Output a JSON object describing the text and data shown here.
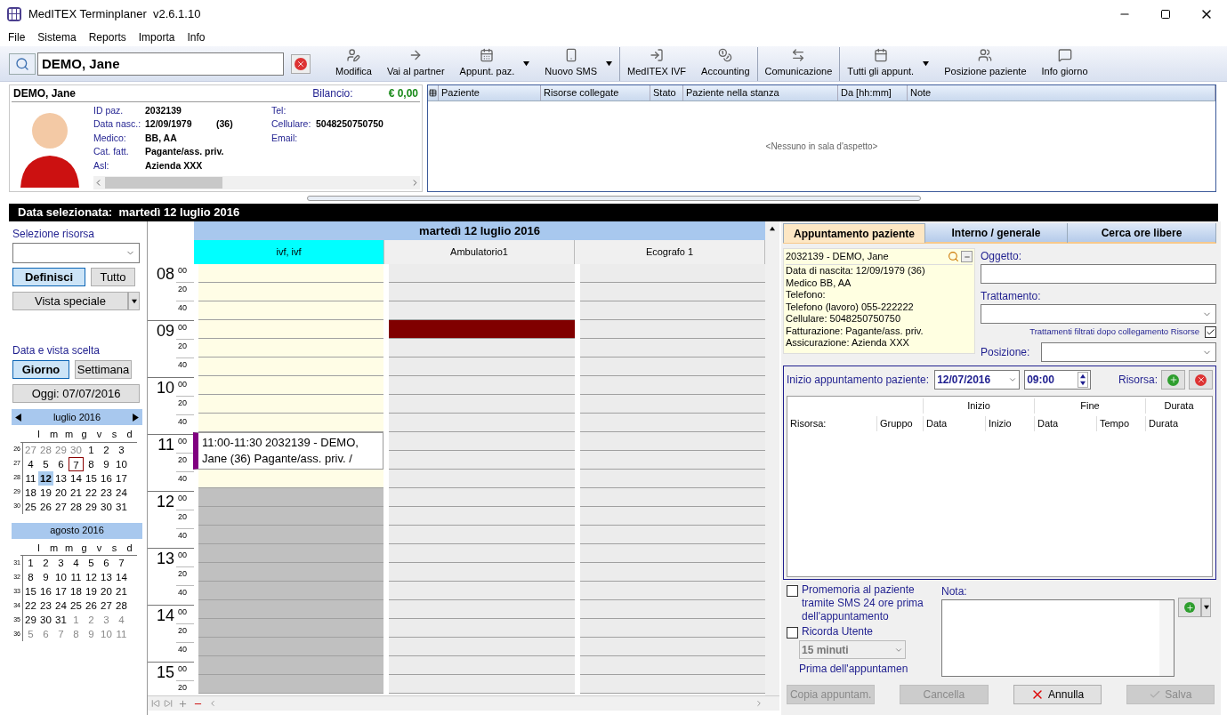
{
  "window": {
    "title": "MedITEX Terminplaner  v2.6.1.10"
  },
  "menu": [
    "File",
    "Sistema",
    "Reports",
    "Importa",
    "Info"
  ],
  "search": {
    "value": "DEMO, Jane"
  },
  "toolbar": [
    {
      "label": "Modifica",
      "dropdown": false,
      "separator_after": false
    },
    {
      "label": "Vai al partner",
      "dropdown": false,
      "separator_after": false
    },
    {
      "label": "Appunt. paz.",
      "dropdown": true,
      "separator_after": false
    },
    {
      "label": "Nuovo SMS",
      "dropdown": true,
      "separator_after": true
    },
    {
      "label": "MedITEX IVF",
      "dropdown": false,
      "separator_after": false
    },
    {
      "label": "Accounting",
      "dropdown": false,
      "separator_after": true
    },
    {
      "label": "Comunicazione",
      "dropdown": false,
      "separator_after": true
    },
    {
      "label": "Tutti gli appunt.",
      "dropdown": true,
      "separator_after": false
    },
    {
      "label": "Posizione paziente",
      "dropdown": false,
      "separator_after": false
    },
    {
      "label": "Info giorno",
      "dropdown": false,
      "separator_after": false
    }
  ],
  "patient": {
    "name": "DEMO, Jane",
    "balance_label": "Bilancio:",
    "balance": "€ 0,00",
    "fields": [
      {
        "label": "ID paz.",
        "value": "2032139"
      },
      {
        "label": "Data nasc.:",
        "value": "12/09/1979",
        "extra": "(36)"
      },
      {
        "label": "Medico:",
        "value": "BB, AA"
      },
      {
        "label": "Cat. fatt.",
        "value": "Pagante/ass. priv."
      },
      {
        "label": "Asl:",
        "value": "Azienda XXX"
      }
    ],
    "contact": [
      {
        "label": "Tel:"
      },
      {
        "label": "Cellulare:",
        "value": "5048250750750"
      },
      {
        "label": "Email:"
      }
    ]
  },
  "waiting_room": {
    "columns": [
      "Paziente",
      "Risorse collegate",
      "Stato",
      "Paziente nella stanza",
      "Da [hh:mm]",
      "Note"
    ],
    "empty_text": "<Nessuno in sala d'aspetto>"
  },
  "selected_date_bar": "Data selezionata:  martedì 12 luglio 2016",
  "sidebar": {
    "resource_label": "Selezione risorsa",
    "resource_buttons": [
      {
        "label": "Definisci",
        "selected": true
      },
      {
        "label": "Tutto",
        "selected": false
      }
    ],
    "special_view": "Vista speciale",
    "view_label": "Data e vista scelta",
    "view_buttons": [
      {
        "label": "Giorno",
        "selected": true
      },
      {
        "label": "Settimana",
        "selected": false
      }
    ],
    "today_button": "Oggi: 07/07/2016",
    "months": [
      {
        "title": "luglio 2016",
        "nav": true,
        "weekdays": [
          "l",
          "m",
          "m",
          "g",
          "v",
          "s",
          "d"
        ],
        "weeks": [
          {
            "number": "26",
            "days": [
              {
                "label": "27",
                "kind": "other"
              },
              {
                "label": "28",
                "kind": "other"
              },
              {
                "label": "29",
                "kind": "other"
              },
              {
                "label": "30",
                "kind": "other"
              },
              {
                "label": "1",
                "kind": "day"
              },
              {
                "label": "2",
                "kind": "day"
              },
              {
                "label": "3",
                "kind": "day"
              }
            ]
          },
          {
            "number": "27",
            "days": [
              {
                "label": "4",
                "kind": "day"
              },
              {
                "label": "5",
                "kind": "day"
              },
              {
                "label": "6",
                "kind": "day"
              },
              {
                "label": "7",
                "kind": "today"
              },
              {
                "label": "8",
                "kind": "day"
              },
              {
                "label": "9",
                "kind": "day"
              },
              {
                "label": "10",
                "kind": "day"
              }
            ]
          },
          {
            "number": "28",
            "days": [
              {
                "label": "11",
                "kind": "day"
              },
              {
                "label": "12",
                "kind": "selected"
              },
              {
                "label": "13",
                "kind": "day"
              },
              {
                "label": "14",
                "kind": "day"
              },
              {
                "label": "15",
                "kind": "day"
              },
              {
                "label": "16",
                "kind": "day"
              },
              {
                "label": "17",
                "kind": "day"
              }
            ]
          },
          {
            "number": "29",
            "days": [
              {
                "label": "18",
                "kind": "day"
              },
              {
                "label": "19",
                "kind": "day"
              },
              {
                "label": "20",
                "kind": "day"
              },
              {
                "label": "21",
                "kind": "day"
              },
              {
                "label": "22",
                "kind": "day"
              },
              {
                "label": "23",
                "kind": "day"
              },
              {
                "label": "24",
                "kind": "day"
              }
            ]
          },
          {
            "number": "30",
            "days": [
              {
                "label": "25",
                "kind": "day"
              },
              {
                "label": "26",
                "kind": "day"
              },
              {
                "label": "27",
                "kind": "day"
              },
              {
                "label": "28",
                "kind": "day"
              },
              {
                "label": "29",
                "kind": "day"
              },
              {
                "label": "30",
                "kind": "day"
              },
              {
                "label": "31",
                "kind": "day"
              }
            ]
          }
        ]
      },
      {
        "title": "agosto 2016",
        "nav": false,
        "weekdays": [
          "l",
          "m",
          "m",
          "g",
          "v",
          "s",
          "d"
        ],
        "weeks": [
          {
            "number": "31",
            "days": [
              {
                "label": "1",
                "kind": "day"
              },
              {
                "label": "2",
                "kind": "day"
              },
              {
                "label": "3",
                "kind": "day"
              },
              {
                "label": "4",
                "kind": "day"
              },
              {
                "label": "5",
                "kind": "day"
              },
              {
                "label": "6",
                "kind": "day"
              },
              {
                "label": "7",
                "kind": "day"
              }
            ]
          },
          {
            "number": "32",
            "days": [
              {
                "label": "8",
                "kind": "day"
              },
              {
                "label": "9",
                "kind": "day"
              },
              {
                "label": "10",
                "kind": "day"
              },
              {
                "label": "11",
                "kind": "day"
              },
              {
                "label": "12",
                "kind": "day"
              },
              {
                "label": "13",
                "kind": "day"
              },
              {
                "label": "14",
                "kind": "day"
              }
            ]
          },
          {
            "number": "33",
            "days": [
              {
                "label": "15",
                "kind": "day"
              },
              {
                "label": "16",
                "kind": "day"
              },
              {
                "label": "17",
                "kind": "day"
              },
              {
                "label": "18",
                "kind": "day"
              },
              {
                "label": "19",
                "kind": "day"
              },
              {
                "label": "20",
                "kind": "day"
              },
              {
                "label": "21",
                "kind": "day"
              }
            ]
          },
          {
            "number": "34",
            "days": [
              {
                "label": "22",
                "kind": "day"
              },
              {
                "label": "23",
                "kind": "day"
              },
              {
                "label": "24",
                "kind": "day"
              },
              {
                "label": "25",
                "kind": "day"
              },
              {
                "label": "26",
                "kind": "day"
              },
              {
                "label": "27",
                "kind": "day"
              },
              {
                "label": "28",
                "kind": "day"
              }
            ]
          },
          {
            "number": "35",
            "days": [
              {
                "label": "29",
                "kind": "day"
              },
              {
                "label": "30",
                "kind": "day"
              },
              {
                "label": "31",
                "kind": "day"
              },
              {
                "label": "1",
                "kind": "other"
              },
              {
                "label": "2",
                "kind": "other"
              },
              {
                "label": "3",
                "kind": "other"
              },
              {
                "label": "4",
                "kind": "other"
              }
            ]
          },
          {
            "number": "36",
            "days": [
              {
                "label": "5",
                "kind": "other"
              },
              {
                "label": "6",
                "kind": "other"
              },
              {
                "label": "7",
                "kind": "other"
              },
              {
                "label": "8",
                "kind": "other"
              },
              {
                "label": "9",
                "kind": "other"
              },
              {
                "label": "10",
                "kind": "other"
              },
              {
                "label": "11",
                "kind": "other"
              }
            ]
          }
        ]
      }
    ]
  },
  "day_view": {
    "title": "martedì 12 luglio 2016",
    "hours": [
      {
        "hour": "08",
        "minutes": [
          "00",
          "20",
          "40"
        ]
      },
      {
        "hour": "09",
        "minutes": [
          "00",
          "20",
          "40"
        ]
      },
      {
        "hour": "10",
        "minutes": [
          "00",
          "20",
          "40"
        ]
      },
      {
        "hour": "11",
        "minutes": [
          "00",
          "20",
          "40"
        ]
      },
      {
        "hour": "12",
        "minutes": [
          "00",
          "20",
          "40"
        ]
      },
      {
        "hour": "13",
        "minutes": [
          "00",
          "20",
          "40"
        ]
      },
      {
        "hour": "14",
        "minutes": [
          "00",
          "20",
          "40"
        ]
      },
      {
        "hour": "15",
        "minutes": [
          "00",
          "20"
        ]
      }
    ],
    "columns": [
      {
        "label": "ivf, ivf",
        "highlighted": true,
        "slots": [
          {
            "kind": "open"
          },
          {
            "kind": "open"
          },
          {
            "kind": "open"
          },
          {
            "kind": "open"
          },
          {
            "kind": "open"
          },
          {
            "kind": "open"
          },
          {
            "kind": "open"
          },
          {
            "kind": "open"
          },
          {
            "kind": "open"
          },
          {
            "kind": "appointment",
            "text": "11:00-11:30 2032139 - DEMO, Jane (36) Pagante/ass. priv. /"
          },
          {
            "kind": "open"
          },
          {
            "kind": "blocked"
          },
          {
            "kind": "blocked"
          },
          {
            "kind": "blocked"
          },
          {
            "kind": "blocked"
          },
          {
            "kind": "blocked"
          },
          {
            "kind": "blocked"
          },
          {
            "kind": "blocked"
          },
          {
            "kind": "blocked"
          },
          {
            "kind": "blocked"
          },
          {
            "kind": "blocked"
          },
          {
            "kind": "blocked"
          }
        ]
      },
      {
        "label": "Ambulatorio1",
        "highlighted": false,
        "slots": [
          {
            "kind": "closed"
          },
          {
            "kind": "closed"
          },
          {
            "kind": "closed"
          },
          {
            "kind": "booked"
          },
          {
            "kind": "closed"
          },
          {
            "kind": "closed"
          },
          {
            "kind": "closed"
          },
          {
            "kind": "closed"
          },
          {
            "kind": "closed"
          },
          {
            "kind": "closed"
          },
          {
            "kind": "closed"
          },
          {
            "kind": "closed"
          },
          {
            "kind": "closed"
          },
          {
            "kind": "closed"
          },
          {
            "kind": "closed"
          },
          {
            "kind": "closed"
          },
          {
            "kind": "closed"
          },
          {
            "kind": "closed"
          },
          {
            "kind": "closed"
          },
          {
            "kind": "closed"
          },
          {
            "kind": "closed"
          },
          {
            "kind": "closed"
          },
          {
            "kind": "closed"
          }
        ]
      },
      {
        "label": "Ecografo 1",
        "highlighted": false,
        "slots": [
          {
            "kind": "closed"
          },
          {
            "kind": "closed"
          },
          {
            "kind": "closed"
          },
          {
            "kind": "closed"
          },
          {
            "kind": "closed"
          },
          {
            "kind": "closed"
          },
          {
            "kind": "closed"
          },
          {
            "kind": "closed"
          },
          {
            "kind": "closed"
          },
          {
            "kind": "closed"
          },
          {
            "kind": "closed"
          },
          {
            "kind": "closed"
          },
          {
            "kind": "closed"
          },
          {
            "kind": "closed"
          },
          {
            "kind": "closed"
          },
          {
            "kind": "closed"
          },
          {
            "kind": "closed"
          },
          {
            "kind": "closed"
          },
          {
            "kind": "closed"
          },
          {
            "kind": "closed"
          },
          {
            "kind": "closed"
          },
          {
            "kind": "closed"
          },
          {
            "kind": "closed"
          }
        ]
      }
    ]
  },
  "appointment_form": {
    "tabs": [
      {
        "label": "Appuntamento paziente",
        "selected": true
      },
      {
        "label": "Interno / generale",
        "selected": false
      },
      {
        "label": "Cerca ore libere",
        "selected": false
      }
    ],
    "patient_header": "2032139 - DEMO, Jane",
    "patient_lines": [
      "Data di nascita: 12/09/1979 (36)",
      "Medico BB, AA",
      "Telefono:",
      "Telefono (lavoro) 055-222222",
      "Cellulare: 5048250750750",
      "Fatturazione: Pagante/ass. priv.",
      "Assicurazione: Azienda XXX"
    ],
    "subject_label": "Oggetto:",
    "treatment_label": "Trattamento:",
    "filter": {
      "label": "Trattamenti filtrati dopo collegamento Risorse",
      "checked": true
    },
    "position_label": "Posizione:",
    "start_label": "Inizio appuntamento paziente:",
    "start_date": "12/07/2016",
    "start_time": "09:00",
    "resource_label": "Risorsa:",
    "group_headers": [
      "Inizio",
      "Fine",
      "Durata"
    ],
    "table_columns": [
      "Risorsa:",
      "Gruppo",
      "Data",
      "Inizio",
      "Data",
      "Tempo",
      "Durata"
    ],
    "reminders": [
      {
        "label": "Promemoria al paziente tramite SMS 24 ore prima dell'appuntamento",
        "checked": false
      },
      {
        "label": "Ricorda Utente",
        "checked": false
      }
    ],
    "reminder_time": "15 minuti",
    "reminder_suffix": "Prima dell'appuntamen",
    "note_label": "Nota:",
    "buttons": [
      {
        "label": "Copia appuntam.",
        "disabled": true,
        "kind": "plain"
      },
      {
        "label": "Cancella",
        "disabled": true,
        "kind": "plain"
      },
      {
        "label": "Annulla",
        "disabled": false,
        "kind": "cancel"
      },
      {
        "label": "Salva",
        "disabled": true,
        "kind": "save"
      }
    ]
  }
}
